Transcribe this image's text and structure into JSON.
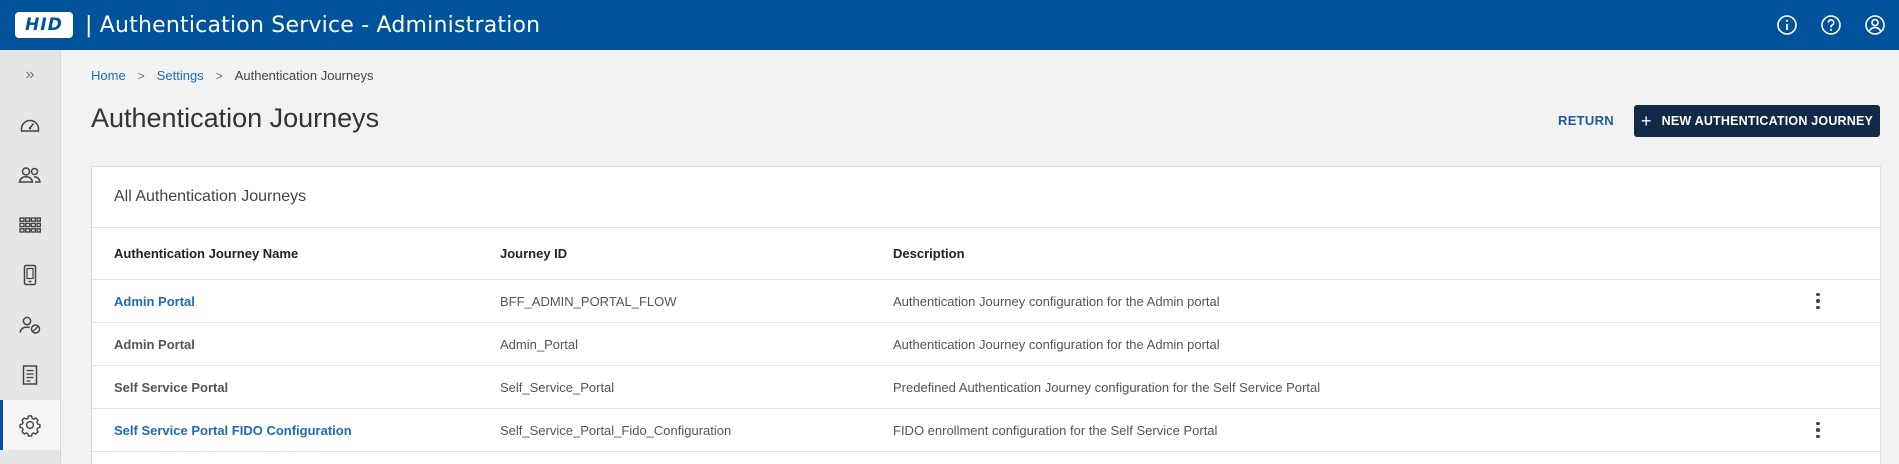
{
  "header": {
    "logo_text": "HID",
    "app_title": "| Authentication Service - Administration",
    "icons": [
      "info-icon",
      "help-icon",
      "user-account-icon"
    ]
  },
  "sidebar": {
    "expand_glyph": "»",
    "items": [
      {
        "icon": "dashboard-icon"
      },
      {
        "icon": "users-icon"
      },
      {
        "icon": "apps-grid-icon"
      },
      {
        "icon": "mobile-device-icon"
      },
      {
        "icon": "user-security-icon"
      },
      {
        "icon": "audit-log-icon"
      },
      {
        "icon": "settings-icon",
        "active": true
      }
    ]
  },
  "breadcrumb": {
    "home": "Home",
    "settings": "Settings",
    "current": "Authentication Journeys"
  },
  "page": {
    "title": "Authentication Journeys",
    "return_label": "RETURN",
    "new_label": "NEW AUTHENTICATION JOURNEY"
  },
  "table": {
    "card_title": "All Authentication Journeys",
    "columns": [
      "Authentication Journey Name",
      "Journey ID",
      "Description"
    ],
    "rows": [
      {
        "name": "Admin Portal",
        "id": "BFF_ADMIN_PORTAL_FLOW",
        "description": "Authentication Journey configuration for the Admin portal",
        "link": true,
        "menu": true
      },
      {
        "name": "Admin Portal",
        "id": "Admin_Portal",
        "description": "Authentication Journey configuration for the Admin portal",
        "link": false,
        "menu": false
      },
      {
        "name": "Self Service Portal",
        "id": "Self_Service_Portal",
        "description": "Predefined Authentication Journey configuration for the Self Service Portal",
        "link": false,
        "menu": false
      },
      {
        "name": "Self Service Portal FIDO Configuration",
        "id": "Self_Service_Portal_Fido_Configuration",
        "description": "FIDO enrollment configuration for the Self Service Portal",
        "link": true,
        "menu": true
      }
    ]
  },
  "colors": {
    "header_bg": "#00539b",
    "primary_button": "#102a47",
    "link": "#1f6bb3"
  }
}
